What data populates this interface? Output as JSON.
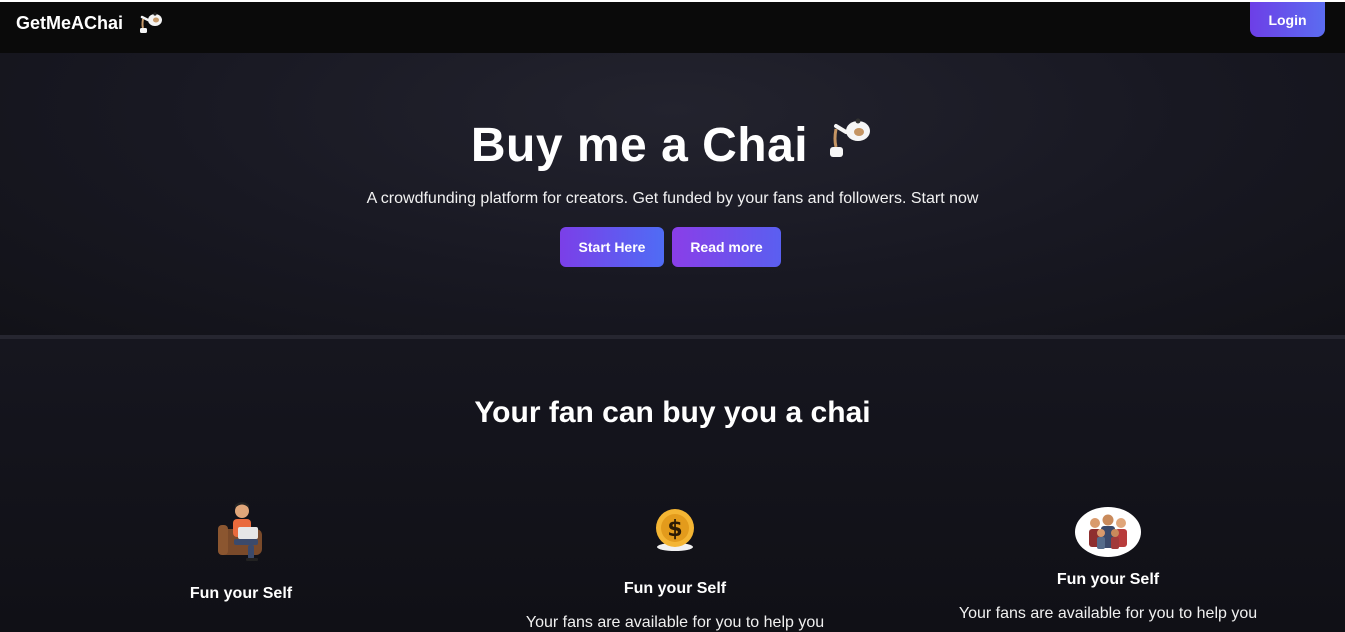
{
  "nav": {
    "brand": "GetMeAChai",
    "brand_icon": "teapot-icon",
    "login_label": "Login"
  },
  "hero": {
    "title": "Buy me a Chai",
    "title_icon": "teapot-icon",
    "subtitle": "A crowdfunding platform for creators. Get funded by your fans and followers. Start now",
    "start_label": "Start Here",
    "read_label": "Read more"
  },
  "section": {
    "title": "Your fan can buy you a chai",
    "features": [
      {
        "icon": "man-with-laptop-icon",
        "title": "Fun your Self",
        "text": ""
      },
      {
        "icon": "coin-icon",
        "title": "Fun your Self",
        "text": "Your fans are available for you to help you"
      },
      {
        "icon": "group-icon",
        "title": "Fun your Self",
        "text": "Your fans are available for you to help you"
      }
    ]
  },
  "colors": {
    "accent_start": "#6d3fe7",
    "accent_end": "#4f6cf5",
    "background": "#0f0f14"
  }
}
